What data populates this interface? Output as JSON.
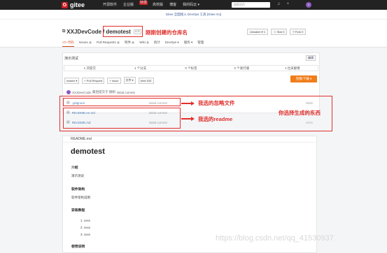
{
  "topbar": {
    "logo": "gitee",
    "nav": [
      "开源软件",
      "企业版",
      "高校版",
      "博客",
      "我的码云 ▾"
    ],
    "hot_badge": "特惠",
    "search_placeholder": "搜索项目",
    "icons": [
      "bell-icon",
      "plus-icon"
    ],
    "avatar_letter": "X"
  },
  "notice": "Gitee 全面接入 DevOps 工具 [Gitee Go]",
  "repo": {
    "owner": "XXJDevCode",
    "separator": "/",
    "name": "demotest",
    "badge": "私有",
    "watch": "Unwatch ▾",
    "watch_count": "1",
    "star": "Star",
    "star_count": "0",
    "fork": "Fork",
    "fork_count": "0"
  },
  "tabs": [
    {
      "label": "代码",
      "active": true
    },
    {
      "label": "Issues",
      "count": "0"
    },
    {
      "label": "Pull Requests",
      "count": "0"
    },
    {
      "label": "附件",
      "count": "0"
    },
    {
      "label": "Wiki",
      "count": "0"
    },
    {
      "label": "统计"
    },
    {
      "label": "DevOps ▾"
    },
    {
      "label": "服务 ▾"
    },
    {
      "label": "管理"
    }
  ],
  "description": "演示测试",
  "edit_label": "编辑",
  "stats": [
    "1 次提交",
    "1 个分支",
    "0 个标签",
    "0 个发行版",
    "1 位贡献者"
  ],
  "toolbar": [
    "master ▾",
    "+ Pull Request",
    "+ Issue",
    "文件 ▾",
    "Web IDE"
  ],
  "clone_label": "克隆/下载 ▾",
  "commit": {
    "author": "XXJDevCode",
    "text": "最后提交于 刚刚",
    "message": "initial commit"
  },
  "files": [
    {
      "name": ".gitignore",
      "message": "initial commit"
    },
    {
      "name": "README.en.md",
      "message": "initial commit"
    },
    {
      "name": "README.md",
      "message": "initial commit"
    }
  ],
  "annotations": {
    "repo_name": "刚刚创建的仓库名",
    "gitignore": "我选的忽略文件",
    "readme": "我选的readme",
    "generated": "你选择生成的东西"
  },
  "readme": {
    "header": "README.md",
    "title": "demotest",
    "intro_h": "介绍",
    "intro": "演示测试",
    "arch_h": "软件架构",
    "arch": "软件架构说明",
    "install_h": "安装教程",
    "install": [
      "1. xxxx",
      "2. xxxx",
      "3. xxxx"
    ],
    "usage_h": "使用说明"
  },
  "watermark": "https://blog.csdn.net/qq_41530937"
}
